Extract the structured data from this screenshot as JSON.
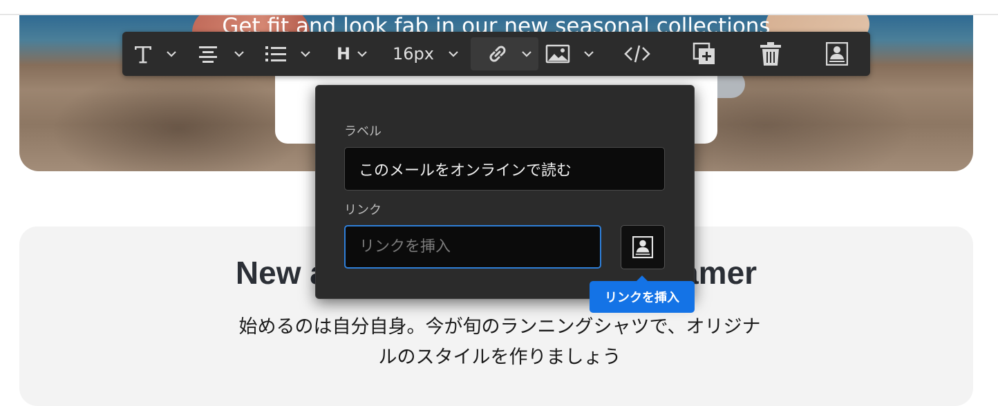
{
  "hero": {
    "headline": "Get fit and look fab in our new seasonal collections"
  },
  "section": {
    "title": "New a                                        amer",
    "body_line1": "始めるのは自分自身。今が旬のランニングシャツで、オリジナ",
    "body_line2": "ルのスタイルを作りましょう"
  },
  "toolbar": {
    "font_size": "16px",
    "heading_label": "H",
    "icons": [
      "text-icon",
      "align-center-icon",
      "list-icon",
      "heading-icon",
      "link-icon",
      "image-icon",
      "code-icon",
      "duplicate-icon",
      "trash-icon",
      "asset-icon"
    ]
  },
  "link_popover": {
    "label_title": "ラベル",
    "label_value": "このメールをオンラインで読む",
    "link_title": "リンク",
    "link_placeholder": "リンクを挿入",
    "tooltip": "リンクを挿入"
  },
  "colors": {
    "toolbar_bg": "#2c2c2c",
    "popover_bg": "#2b2b2b",
    "accent": "#1473e6",
    "focus_border": "#2f7fd9"
  }
}
